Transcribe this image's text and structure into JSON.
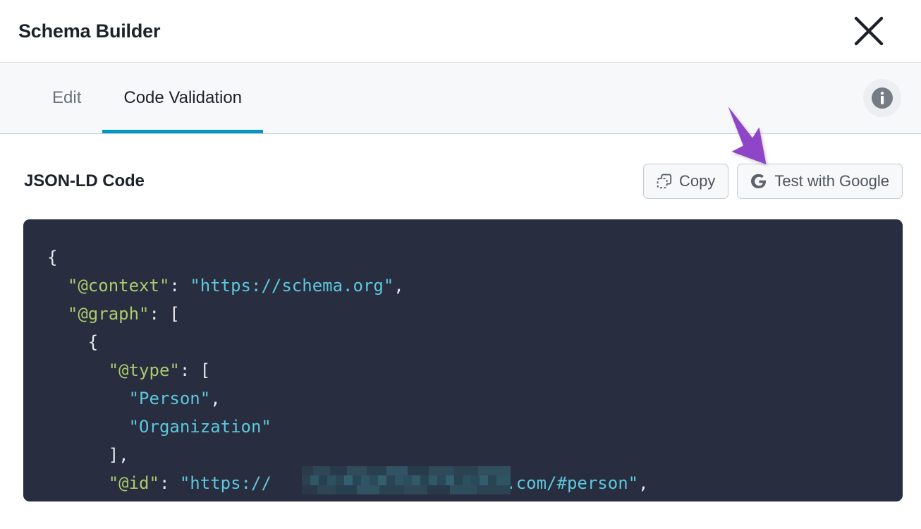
{
  "header": {
    "title": "Schema Builder",
    "close_icon": "close-icon"
  },
  "tabs": {
    "items": [
      {
        "label": "Edit",
        "active": false
      },
      {
        "label": "Code Validation",
        "active": true
      }
    ],
    "info_icon": "info-icon",
    "active_underline_color": "#0099c6"
  },
  "main": {
    "section_title": "JSON-LD Code",
    "actions": [
      {
        "label": "Copy",
        "icon": "copy-icon"
      },
      {
        "label": "Test with Google",
        "icon": "google-g-icon"
      }
    ]
  },
  "code": {
    "language": "json-ld",
    "background_color": "#282d3f",
    "key_color": "#aacb6e",
    "string_color": "#5dc8dd",
    "punct_color": "#e8eaf0",
    "lines": [
      {
        "indent": 0,
        "tokens": [
          {
            "t": "punct",
            "v": "{"
          }
        ]
      },
      {
        "indent": 1,
        "tokens": [
          {
            "t": "key",
            "v": "\"@context\""
          },
          {
            "t": "punct",
            "v": ": "
          },
          {
            "t": "str",
            "v": "\"https://schema.org\""
          },
          {
            "t": "punct",
            "v": ","
          }
        ]
      },
      {
        "indent": 1,
        "tokens": [
          {
            "t": "key",
            "v": "\"@graph\""
          },
          {
            "t": "punct",
            "v": ": ["
          }
        ]
      },
      {
        "indent": 2,
        "tokens": [
          {
            "t": "punct",
            "v": "{"
          }
        ]
      },
      {
        "indent": 3,
        "tokens": [
          {
            "t": "key",
            "v": "\"@type\""
          },
          {
            "t": "punct",
            "v": ": ["
          }
        ]
      },
      {
        "indent": 4,
        "tokens": [
          {
            "t": "str",
            "v": "\"Person\""
          },
          {
            "t": "punct",
            "v": ","
          }
        ]
      },
      {
        "indent": 4,
        "tokens": [
          {
            "t": "str",
            "v": "\"Organization\""
          }
        ]
      },
      {
        "indent": 3,
        "tokens": [
          {
            "t": "punct",
            "v": "],"
          }
        ]
      },
      {
        "indent": 3,
        "tokens": [
          {
            "t": "key",
            "v": "\"@id\""
          },
          {
            "t": "punct",
            "v": ": "
          },
          {
            "t": "str",
            "v": "\"https://"
          },
          {
            "t": "redacted",
            "v": "                       "
          },
          {
            "t": "str",
            "v": ".com/#person\""
          },
          {
            "t": "punct",
            "v": ","
          }
        ]
      }
    ]
  },
  "annotation": {
    "type": "arrow",
    "color": "#8e44c8",
    "points_to": "Test with Google"
  }
}
